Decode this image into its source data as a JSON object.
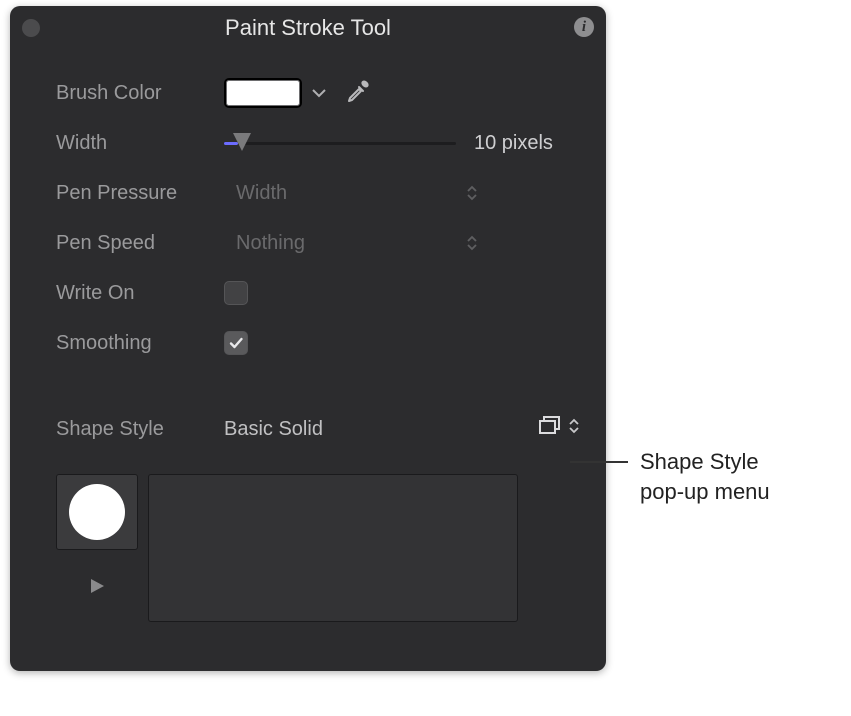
{
  "title": "Paint Stroke Tool",
  "labels": {
    "brush_color": "Brush Color",
    "width": "Width",
    "pen_pressure": "Pen Pressure",
    "pen_speed": "Pen Speed",
    "write_on": "Write On",
    "smoothing": "Smoothing",
    "shape_style": "Shape Style"
  },
  "values": {
    "brush_color_hex": "#ffffff",
    "width_display": "10 pixels",
    "width_slider_pct": 5,
    "pen_pressure_selected": "Width",
    "pen_speed_selected": "Nothing",
    "write_on_checked": false,
    "smoothing_checked": true,
    "shape_style_selected": "Basic Solid"
  },
  "callout": {
    "line1": "Shape Style",
    "line2": "pop-up menu"
  }
}
